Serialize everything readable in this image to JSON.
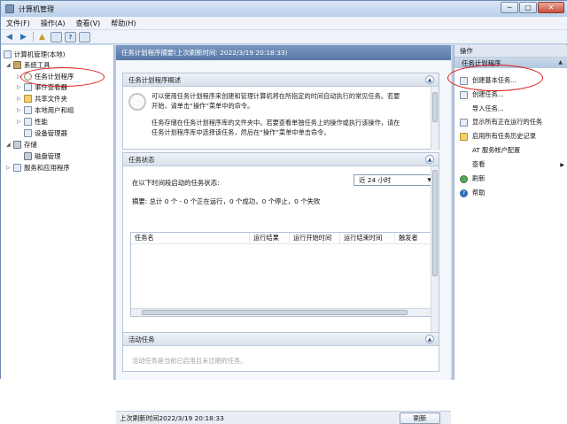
{
  "window": {
    "title": "计算机管理",
    "buttons": {
      "minimize": "─",
      "maximize": "□",
      "close": "✕"
    }
  },
  "menu": [
    "文件(F)",
    "操作(A)",
    "查看(V)",
    "帮助(H)"
  ],
  "tree": {
    "root": "计算机管理(本地)",
    "system_tools": "系统工具",
    "task_scheduler": "任务计划程序",
    "event_viewer": "事件查看器",
    "shared_folders": "共享文件夹",
    "local_users": "本地用户和组",
    "performance": "性能",
    "device_manager": "设备管理器",
    "storage": "存储",
    "disk_management": "磁盘管理",
    "services": "服务和应用程序"
  },
  "center": {
    "header": "任务计划程序摘要(上次刷新时间: 2022/3/19 20:18:33)",
    "overview_title": "任务计划程序概述",
    "overview_line1": "可以使用任务计划程序来创建和管理计算机将在所指定的时间自动执行的常见任务。若要",
    "overview_line2": "开始，请单击“操作”菜单中的命令。",
    "overview_line3": "任务存储在任务计划程序库的文件夹中。若要查看单独任务上的操作或执行该操作，请在",
    "overview_line4": "任务计划程序库中选择该任务，然后在“操作”菜单中单击命令。",
    "status_title": "任务状态",
    "status_prompt": "在以下时间段启动的任务状态:",
    "period": "近 24 小时",
    "summary": "摘要: 总计 0 个 - 0 个正在运行，0 个成功，0 个停止，0 个失败",
    "columns": [
      "任务名",
      "运行结果",
      "运行开始时间",
      "运行结束时间",
      "触发者"
    ],
    "active_title": "活动任务",
    "active_desc": "活动任务是当前已启用且未过期的任务。",
    "last_refresh": "上次刷新时间2022/3/19 20:18:33",
    "refresh_button": "刷新"
  },
  "actions": {
    "title": "操作",
    "group": "任务计划程序",
    "items": [
      {
        "label": "创建基本任务...",
        "icon": "create-basic-task-icon"
      },
      {
        "label": "创建任务...",
        "icon": "create-task-icon"
      },
      {
        "label": "导入任务...",
        "icon": "import-task-icon"
      },
      {
        "label": "显示所有正在运行的任务",
        "icon": "running-tasks-icon"
      },
      {
        "label": "启用所有任务历史记录",
        "icon": "history-icon"
      },
      {
        "label": "AT 服务帐户配置",
        "icon": "blank"
      },
      {
        "label": "查看",
        "icon": "blank"
      },
      {
        "label": "刷新",
        "icon": "refresh-icon"
      },
      {
        "label": "帮助",
        "icon": "help-icon"
      }
    ]
  },
  "colors": {
    "highlight_oval": "#dd1111",
    "header_blue": "#5677a6",
    "window_frame": "#cfe0f2"
  }
}
